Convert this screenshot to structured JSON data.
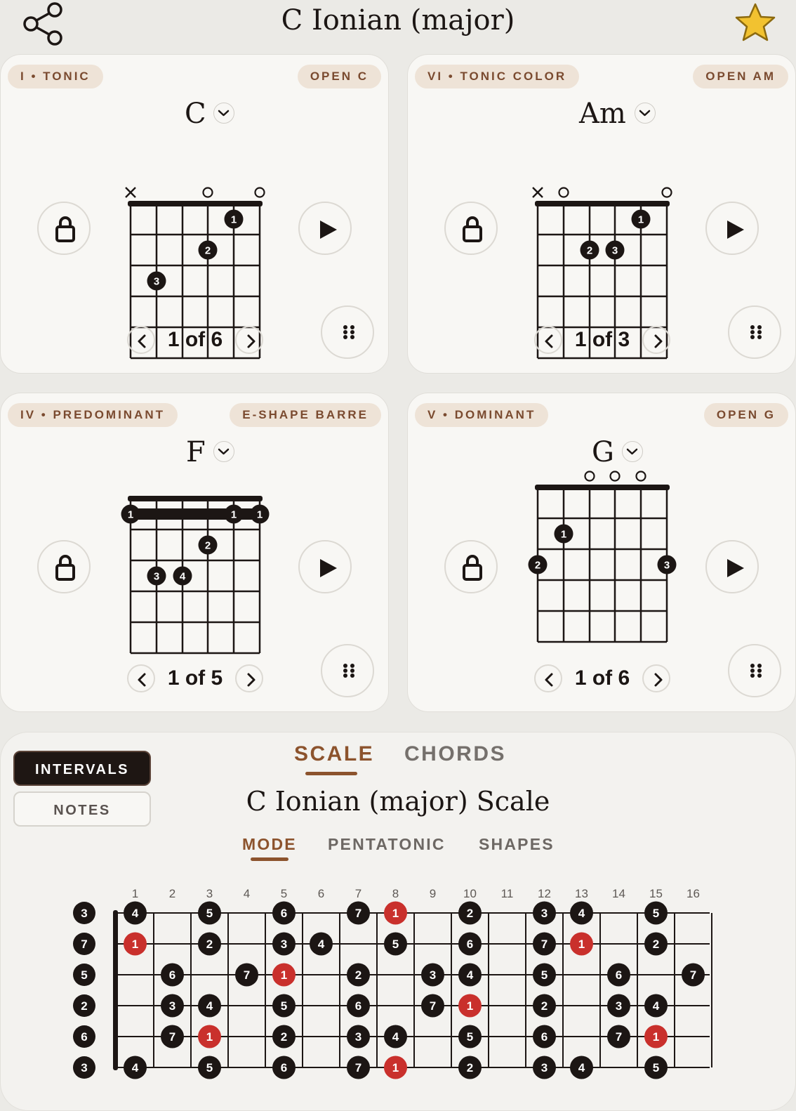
{
  "header": {
    "title": "C Ionian (major)",
    "share_icon": "share-icon",
    "favorite_icon": "star-icon",
    "star_color": "#f2c230"
  },
  "cards": [
    {
      "function_label": "I • TONIC",
      "voicing_label": "OPEN C",
      "chord": "C",
      "page": "1 of 6",
      "strings": [
        "x",
        "",
        "",
        "o",
        "",
        "o"
      ],
      "nut": true,
      "barre": null,
      "dots": [
        {
          "string": 5,
          "fret": 1,
          "finger": "1"
        },
        {
          "string": 4,
          "fret": 2,
          "finger": "2"
        },
        {
          "string": 2,
          "fret": 3,
          "finger": "3"
        }
      ]
    },
    {
      "function_label": "VI • TONIC COLOR",
      "voicing_label": "OPEN AM",
      "chord": "Am",
      "page": "1 of 3",
      "strings": [
        "x",
        "o",
        "",
        "",
        "",
        "o"
      ],
      "nut": true,
      "barre": null,
      "dots": [
        {
          "string": 5,
          "fret": 1,
          "finger": "1"
        },
        {
          "string": 3,
          "fret": 2,
          "finger": "2"
        },
        {
          "string": 4,
          "fret": 2,
          "finger": "3"
        }
      ]
    },
    {
      "function_label": "IV • PREDOMINANT",
      "voicing_label": "E-SHAPE BARRE",
      "chord": "F",
      "page": "1 of 5",
      "strings": [
        "",
        "",
        "",
        "",
        "",
        ""
      ],
      "nut": true,
      "barre": {
        "fret": 1,
        "finger": "1"
      },
      "dots": [
        {
          "string": 4,
          "fret": 2,
          "finger": "2"
        },
        {
          "string": 2,
          "fret": 3,
          "finger": "3"
        },
        {
          "string": 3,
          "fret": 3,
          "finger": "4"
        }
      ]
    },
    {
      "function_label": "V • DOMINANT",
      "voicing_label": "OPEN G",
      "chord": "G",
      "page": "1 of 6",
      "strings": [
        "",
        "",
        "o",
        "o",
        "o",
        ""
      ],
      "nut": true,
      "barre": null,
      "dots": [
        {
          "string": 2,
          "fret": 2,
          "finger": "1"
        },
        {
          "string": 1,
          "fret": 3,
          "finger": "2"
        },
        {
          "string": 6,
          "fret": 3,
          "finger": "3"
        }
      ]
    }
  ],
  "card_icons": {
    "lock": "lock-icon",
    "play": "play-icon",
    "more": "grip-icon",
    "prev": "chevron-left-icon",
    "next": "chevron-right-icon",
    "dropdown": "chevron-down-icon"
  },
  "scale_panel": {
    "display_modes": [
      "INTERVALS",
      "NOTES"
    ],
    "active_display_mode": "INTERVALS",
    "tabs": [
      "SCALE",
      "CHORDS"
    ],
    "active_tab": "SCALE",
    "title": "C Ionian (major) Scale",
    "subtabs": [
      "MODE",
      "PENTATONIC",
      "SHAPES"
    ],
    "active_subtab": "MODE",
    "root_color": "#c9302c",
    "fret_numbers": [
      "1",
      "2",
      "3",
      "4",
      "5",
      "6",
      "7",
      "8",
      "9",
      "10",
      "11",
      "12",
      "13",
      "14",
      "15",
      "16"
    ],
    "open_strings": [
      "3",
      "7",
      "5",
      "2",
      "6",
      "3"
    ],
    "rows": [
      {
        "notes": [
          [
            1,
            "4"
          ],
          [
            3,
            "5"
          ],
          [
            5,
            "6"
          ],
          [
            7,
            "7"
          ],
          [
            8,
            "1"
          ],
          [
            10,
            "2"
          ],
          [
            12,
            "3"
          ],
          [
            13,
            "4"
          ],
          [
            15,
            "5"
          ]
        ]
      },
      {
        "notes": [
          [
            1,
            "1"
          ],
          [
            3,
            "2"
          ],
          [
            5,
            "3"
          ],
          [
            6,
            "4"
          ],
          [
            8,
            "5"
          ],
          [
            10,
            "6"
          ],
          [
            12,
            "7"
          ],
          [
            13,
            "1"
          ],
          [
            15,
            "2"
          ]
        ]
      },
      {
        "notes": [
          [
            2,
            "6"
          ],
          [
            4,
            "7"
          ],
          [
            5,
            "1"
          ],
          [
            7,
            "2"
          ],
          [
            9,
            "3"
          ],
          [
            10,
            "4"
          ],
          [
            12,
            "5"
          ],
          [
            14,
            "6"
          ],
          [
            16,
            "7"
          ]
        ]
      },
      {
        "notes": [
          [
            2,
            "3"
          ],
          [
            3,
            "4"
          ],
          [
            5,
            "5"
          ],
          [
            7,
            "6"
          ],
          [
            9,
            "7"
          ],
          [
            10,
            "1"
          ],
          [
            12,
            "2"
          ],
          [
            14,
            "3"
          ],
          [
            15,
            "4"
          ]
        ]
      },
      {
        "notes": [
          [
            2,
            "7"
          ],
          [
            3,
            "1"
          ],
          [
            5,
            "2"
          ],
          [
            7,
            "3"
          ],
          [
            8,
            "4"
          ],
          [
            10,
            "5"
          ],
          [
            12,
            "6"
          ],
          [
            14,
            "7"
          ],
          [
            15,
            "1"
          ]
        ]
      },
      {
        "notes": [
          [
            1,
            "4"
          ],
          [
            3,
            "5"
          ],
          [
            5,
            "6"
          ],
          [
            7,
            "7"
          ],
          [
            8,
            "1"
          ],
          [
            10,
            "2"
          ],
          [
            12,
            "3"
          ],
          [
            13,
            "4"
          ],
          [
            15,
            "5"
          ]
        ]
      }
    ]
  }
}
